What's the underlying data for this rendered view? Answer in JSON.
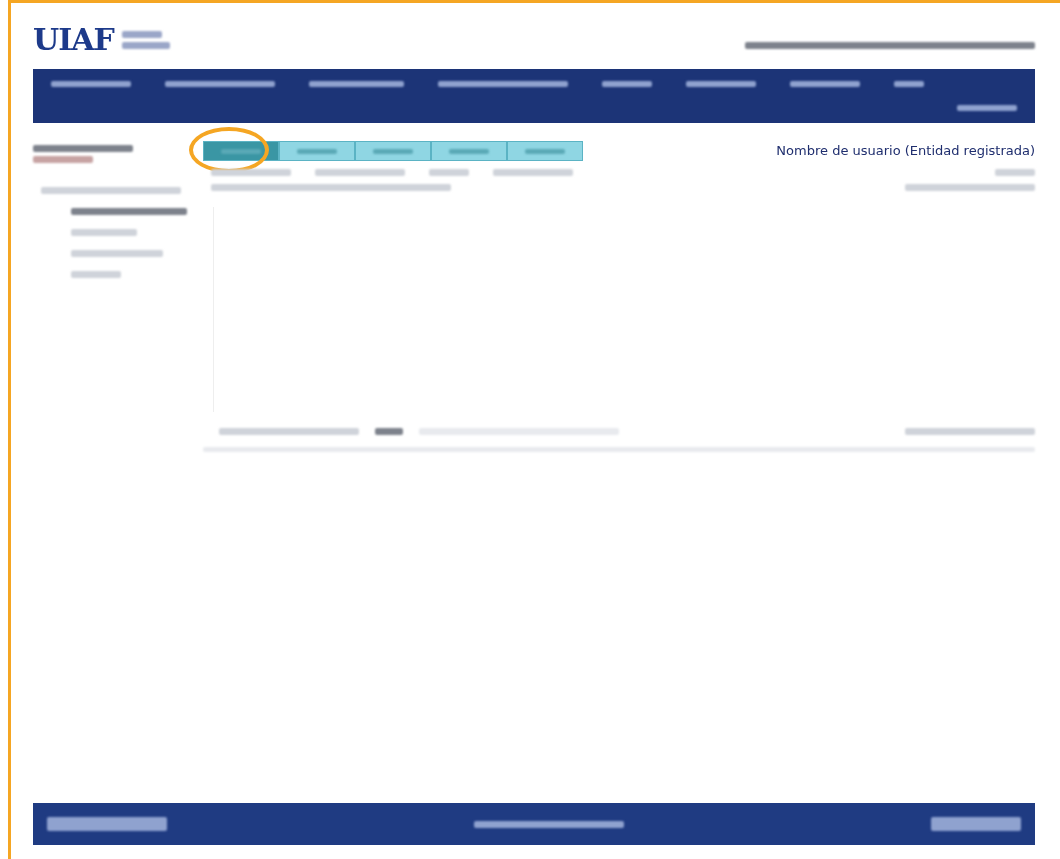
{
  "header": {
    "logo": "UIAF"
  },
  "tabs": [
    {
      "selected": true,
      "annotated": true
    },
    {
      "selected": false,
      "annotated": false
    },
    {
      "selected": false,
      "annotated": false
    },
    {
      "selected": false,
      "annotated": false
    },
    {
      "selected": false,
      "annotated": false
    }
  ],
  "user_label": "Nombre de usuario (Entidad registrada)"
}
